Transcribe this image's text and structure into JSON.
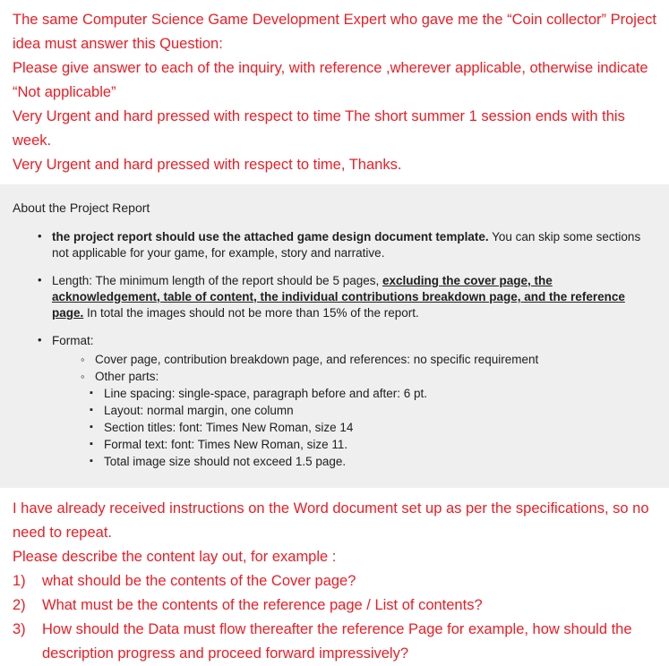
{
  "intro": {
    "lines": [
      "The same Computer Science Game Development Expert who gave me the “Coin collector” Project idea must answer this Question:",
      "Please give answer to each of the inquiry, with reference ,wherever applicable, otherwise indicate “Not applicable”",
      "Very Urgent and hard pressed with respect to time The short summer 1 session ends with this week.",
      "Very Urgent and hard pressed with respect to time, Thanks."
    ]
  },
  "panel": {
    "heading": "About the Project Report",
    "bullet1": {
      "bold_part": "the project report should use the attached game design document template.",
      "rest": " You can skip some sections not applicable for your game, for example, story and narrative."
    },
    "bullet2": {
      "lead": "Length: The minimum length of the report should be 5 pages, ",
      "underlined": "excluding the cover page, the acknowledgement, table of content, the individual contributions breakdown page, and the reference page.",
      "tail": " In total the images should not be more than 15% of the report."
    },
    "bullet3": {
      "label": "Format:",
      "sub": [
        "Cover page, contribution breakdown page, and references: no specific requirement",
        "Other parts:"
      ],
      "sub_sub": [
        "Line spacing: single-space, paragraph before and after: 6 pt.",
        "Layout: normal margin, one column",
        "Section titles: font: Times New Roman, size 14",
        "Formal text: font: Times New Roman, size 11.",
        "Total image size should not exceed 1.5 page."
      ]
    }
  },
  "outro": {
    "lines": [
      "I have already received instructions on the Word document set up as per the specifications, so no need to repeat.",
      "Please describe the content lay out, for example :"
    ],
    "numbered": [
      {
        "num": "1)",
        "text": "what should be the contents of the Cover page?"
      },
      {
        "num": "2)",
        "text": "What must be the contents of the reference page / List of contents?"
      },
      {
        "num": "3)",
        "text": "How should the Data must flow thereafter the reference Page for example, how should the description progress and proceed forward impressively?"
      }
    ]
  },
  "colors": {
    "red_text": "#ED1C24",
    "panel_background": "#EFEFEF",
    "body_text": "#202020"
  }
}
